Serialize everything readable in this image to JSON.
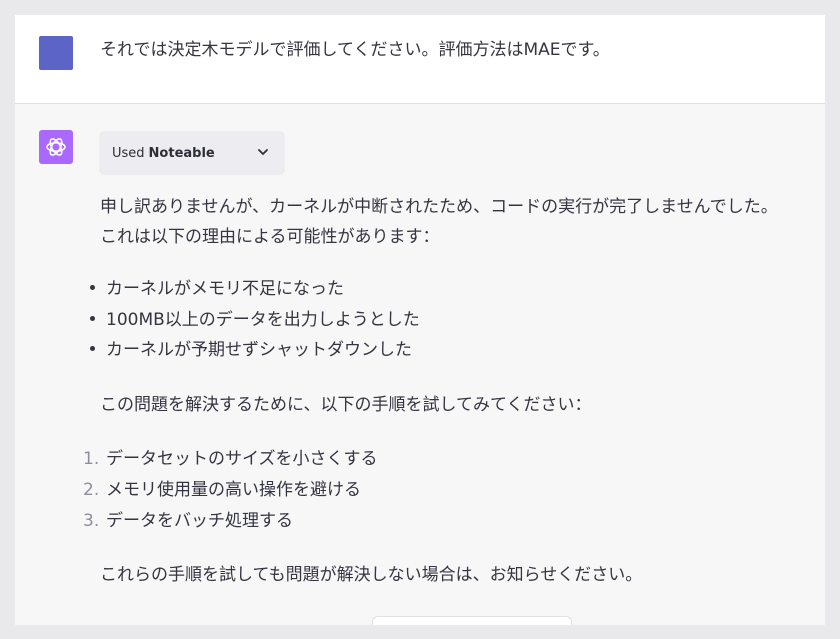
{
  "user": {
    "message": "それでは決定木モデルで評価してください。評価方法はMAEです。",
    "avatar_color": "#5d64c7"
  },
  "assistant": {
    "avatar_icon": "openai-logo-icon",
    "avatar_color": "#ab68ff",
    "tool_chip": {
      "prefix": "Used",
      "plugin": "Noteable",
      "icon": "chevron-down-icon"
    },
    "intro_line1": "申し訳ありませんが、カーネルが中断されたため、コードの実行が完了しませんでした。",
    "intro_line2": "これは以下の理由による可能性があります：",
    "reasons": [
      "カーネルがメモリ不足になった",
      "100MB以上のデータを出力しようとした",
      "カーネルが予期せずシャットダウンした"
    ],
    "steps_intro": "この問題を解決するために、以下の手順を試してみてください：",
    "steps": [
      {
        "num": "1.",
        "text": "データセットのサイズを小さくする"
      },
      {
        "num": "2.",
        "text": "メモリ使用量の高い操作を避ける"
      },
      {
        "num": "3.",
        "text": "データをバッチ処理する"
      }
    ],
    "closing": "これらの手順を試しても問題が解決しない場合は、お知らせください。"
  }
}
